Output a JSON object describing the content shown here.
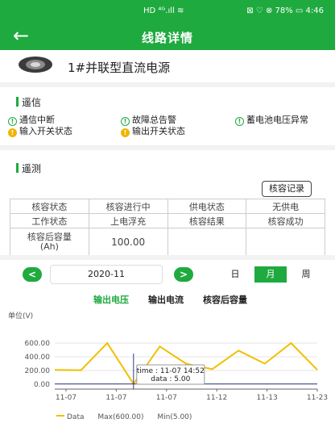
{
  "status": {
    "left": "HD ⁴ᴳ.ıll ≋",
    "right": "⊠ ♡ ⊗ 78% ▭ 4:46"
  },
  "nav": {
    "title": "线路详情"
  },
  "device": {
    "name": "1#并联型直流电源"
  },
  "telesignal": {
    "title": "遥信",
    "items": [
      {
        "label": "通信中断",
        "state": "green"
      },
      {
        "label": "故障总告警",
        "state": "green"
      },
      {
        "label": "蓄电池电压异常",
        "state": "green"
      },
      {
        "label": "输入开关状态",
        "state": "yellow"
      },
      {
        "label": "输出开关状态",
        "state": "yellow"
      }
    ]
  },
  "telemetry": {
    "title": "遥测",
    "record_button": "核容记录",
    "rows": [
      [
        "核容状态",
        "核容进行中",
        "供电状态",
        "无供电"
      ],
      [
        "工作状态",
        "上电浮充",
        "核容结果",
        "核容成功"
      ],
      [
        "核容后容量\n(Ah)",
        "100.00",
        "",
        ""
      ]
    ]
  },
  "period": {
    "prev": "<",
    "next": ">",
    "date": "2020-11",
    "options": [
      "日",
      "月",
      "周"
    ],
    "selected": "月"
  },
  "chart_tabs": {
    "items": [
      "输出电压",
      "输出电流",
      "核容后容量"
    ],
    "active": "输出电压"
  },
  "chart_data": {
    "type": "line",
    "ylabel": "单位(V)",
    "yticks": [
      "600.00",
      "400.00",
      "200.00",
      "0.00"
    ],
    "ylim": [
      -70,
      870
    ],
    "xticks": [
      "11-07",
      "11-07",
      "11-07",
      "11-12",
      "11-13",
      "11-23"
    ],
    "series": [
      {
        "name": "Data",
        "color": "#f0c000",
        "values": [
          210,
          205,
          600,
          5,
          550,
          300,
          220,
          490,
          300,
          600,
          210
        ]
      }
    ],
    "tooltip": {
      "time": "time : 11-07 14:52",
      "data": "data : 5.00"
    },
    "legend": {
      "data": "Data",
      "max": "Max(600.00)",
      "min": "Min(5.00)"
    },
    "highlight_index": 3
  }
}
